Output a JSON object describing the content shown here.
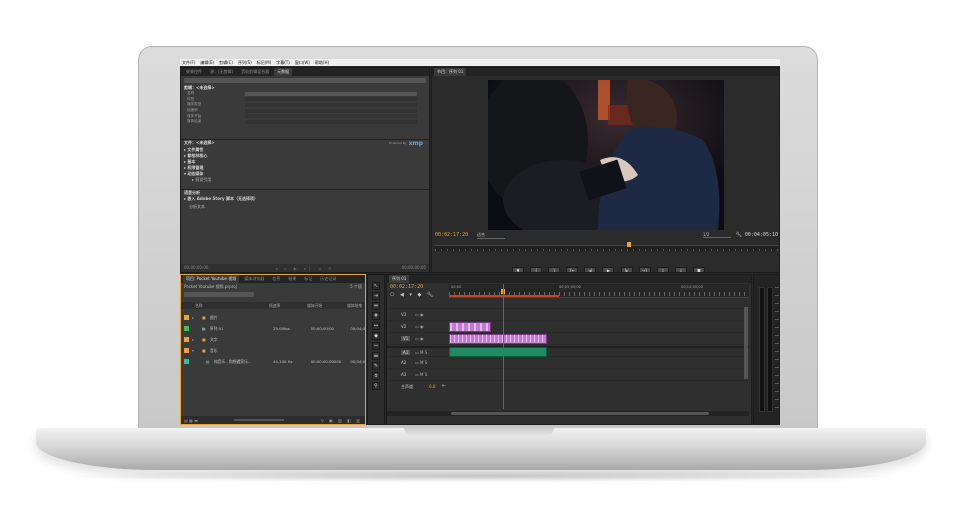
{
  "menu": [
    "文件(F)",
    "编辑(E)",
    "剪辑(C)",
    "序列(S)",
    "标记(M)",
    "字幕(T)",
    "窗口(W)",
    "帮助(H)"
  ],
  "source_panel": {
    "tabs": [
      "效果控件",
      "源：(无剪辑)",
      "音轨剪辑混合器",
      "元数据"
    ],
    "clip_section": "剪辑：<未选择>",
    "clip_fields": [
      "名称",
      "标签",
      "媒体类型",
      "帧速率",
      "媒体开始",
      "媒体结束"
    ],
    "file_section": "文件：<未选择>",
    "xmp_label": "xmp",
    "powered_by": "Powered By",
    "file_fields": [
      "文件属性",
      "都柏林核心",
      "基本",
      "权限管理",
      "动态媒体",
      "但设引用"
    ],
    "speech_section": "语音分析",
    "speech_embed": "嵌入 Adobe Story 脚本（无选择项）",
    "analysis_text": "分析文本",
    "timecode_left": "00;00;00;00",
    "timecode_right": "00;00;00;00"
  },
  "program_monitor": {
    "tab": "节目：序列 01",
    "timecode_current": "00:02:17:20",
    "fit_label": "适合",
    "resolution_label": "1/2",
    "timecode_duration": "00:04:05:10",
    "buttons": [
      "▼",
      "{",
      "}",
      "{←",
      "◂|",
      "▶",
      "|▸",
      "→}",
      "⇧",
      "⇩",
      "◙"
    ]
  },
  "project_panel": {
    "tabs": [
      "项目: Pocket Youtube 视频",
      "媒体浏览器",
      "信息",
      "效果",
      "标记",
      "历史记录"
    ],
    "project_file": "Pocket Youtube 视频.prproj",
    "item_count": "5 个项",
    "columns": [
      "名称",
      "帧速率",
      "媒体开始",
      "媒体结束"
    ],
    "items": [
      {
        "type": "folder",
        "name": "图片",
        "fps": "",
        "start": "",
        "end": "",
        "color": "#e6a23c"
      },
      {
        "type": "sequence",
        "name": "序列 01",
        "fps": "25.00fps",
        "start": "00;00;00;00",
        "end": "00;04;0",
        "color": "#3fbf5a"
      },
      {
        "type": "folder",
        "name": "文字",
        "fps": "",
        "start": "",
        "end": "",
        "color": "#e6a23c"
      },
      {
        "type": "folder",
        "name": "音乐",
        "fps": "",
        "start": "",
        "end": "",
        "color": "#e6a23c"
      },
      {
        "type": "audio",
        "name": "纯音乐 - 和想遇家乐...",
        "fps": "44,100 Hz",
        "start": "00:00:00:00000",
        "end": "00;04;0",
        "color": "#2fbfa0"
      }
    ]
  },
  "timeline": {
    "tab": "序列 01",
    "timecode": "00:02:17:20",
    "ruler": [
      "00;00",
      "00;05;00;00",
      "00;10;00;00"
    ],
    "tracks_video": [
      "V3",
      "V2",
      "V1"
    ],
    "tracks_audio": [
      "A1",
      "A2",
      "A3"
    ],
    "master": "主声道",
    "master_value": "0.0",
    "colors": {
      "video_clip": "#c07ccd",
      "audio_clip": "#1f8a63",
      "playhead": "#d23b2a",
      "accent": "#e8a33a"
    }
  }
}
